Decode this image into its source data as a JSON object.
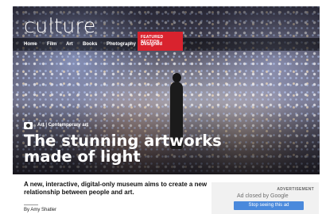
{
  "site": {
    "logo": "culture"
  },
  "nav": {
    "items": [
      "Home",
      "Film",
      "Art",
      "Books",
      "Photography"
    ],
    "featured_label": "FEATURED SECTION",
    "featured_item": "Designed"
  },
  "article": {
    "category": "Art | Contemporary art",
    "title": "The stunning artworks made of light",
    "standfirst": "A new, interactive, digital-only museum aims to create a new relationship between people and art.",
    "byline": "By Amy Shatler"
  },
  "ad": {
    "label": "ADVERTISEMENT",
    "closed_text": "Ad closed by Google",
    "stop_button": "Stop seeing this ad"
  },
  "icons": {
    "category_icon": "camera-icon"
  }
}
